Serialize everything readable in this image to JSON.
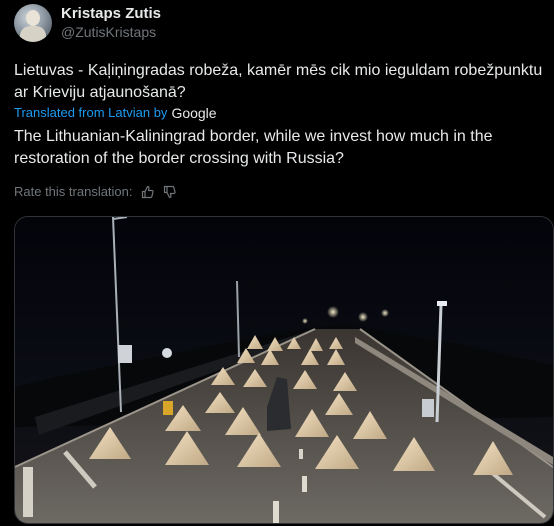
{
  "author": {
    "display_name": "Kristaps Zutis",
    "handle": "@ZutisKristaps"
  },
  "post": {
    "original_text": "Lietuvas - Kaļiņingradas robeža, kamēr mēs cik mio ieguldam robežpunktu ar Krieviju atjaunošanā?",
    "translated_by_label": "Translated from Latvian by",
    "translation_provider": "Google",
    "translated_text": "The Lithuanian-Kaliningrad border, while we invest how much in the restoration of the border crossing with Russia?",
    "rate_label": "Rate this translation:"
  },
  "icons": {
    "thumbs_up": "thumbs-up-icon",
    "thumbs_down": "thumbs-down-icon"
  },
  "colors": {
    "background": "#000000",
    "text": "#e7e9ea",
    "muted": "#71767b",
    "link": "#1d9bf0"
  }
}
